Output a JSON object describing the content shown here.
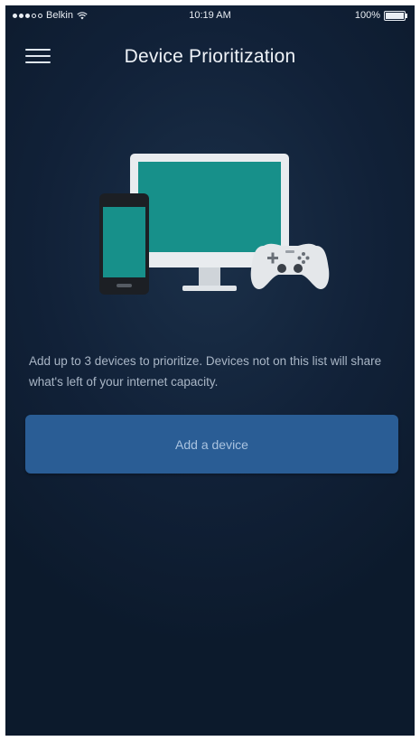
{
  "status_bar": {
    "carrier": "Belkin",
    "time": "10:19 AM",
    "battery": "100%"
  },
  "header": {
    "title": "Device Prioritization"
  },
  "illustration": {
    "icons": [
      "smartphone-icon",
      "monitor-icon",
      "game-controller-icon"
    ]
  },
  "description": "Add up to 3 devices to prioritize. Devices not on this list will share what's left of your internet capacity.",
  "actions": {
    "add_device_label": "Add a device"
  },
  "colors": {
    "background": "#112138",
    "button": "#2a5d95",
    "screen_accent": "#17908a"
  }
}
